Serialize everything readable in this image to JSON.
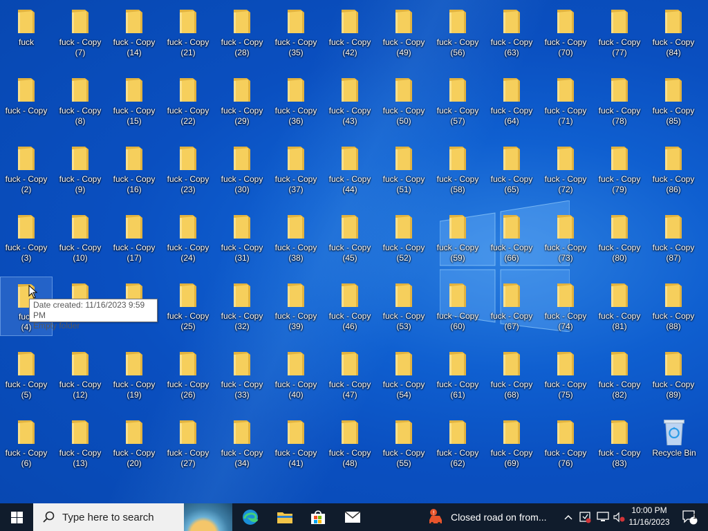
{
  "desktop": {
    "icons": [
      {
        "line1": "fuck",
        "line2": ""
      },
      {
        "line1": "fuck - Copy",
        "line2": "(7)"
      },
      {
        "line1": "fuck - Copy",
        "line2": "(14)"
      },
      {
        "line1": "fuck - Copy",
        "line2": "(21)"
      },
      {
        "line1": "fuck - Copy",
        "line2": "(28)"
      },
      {
        "line1": "fuck - Copy",
        "line2": "(35)"
      },
      {
        "line1": "fuck - Copy",
        "line2": "(42)"
      },
      {
        "line1": "fuck - Copy",
        "line2": "(49)"
      },
      {
        "line1": "fuck - Copy",
        "line2": "(56)"
      },
      {
        "line1": "fuck - Copy",
        "line2": "(63)"
      },
      {
        "line1": "fuck - Copy",
        "line2": "(70)"
      },
      {
        "line1": "fuck - Copy",
        "line2": "(77)"
      },
      {
        "line1": "fuck - Copy",
        "line2": "(84)"
      },
      {
        "line1": "fuck - Copy",
        "line2": ""
      },
      {
        "line1": "fuck - Copy",
        "line2": "(8)"
      },
      {
        "line1": "fuck - Copy",
        "line2": "(15)"
      },
      {
        "line1": "fuck - Copy",
        "line2": "(22)"
      },
      {
        "line1": "fuck - Copy",
        "line2": "(29)"
      },
      {
        "line1": "fuck - Copy",
        "line2": "(36)"
      },
      {
        "line1": "fuck - Copy",
        "line2": "(43)"
      },
      {
        "line1": "fuck - Copy",
        "line2": "(50)"
      },
      {
        "line1": "fuck - Copy",
        "line2": "(57)"
      },
      {
        "line1": "fuck - Copy",
        "line2": "(64)"
      },
      {
        "line1": "fuck - Copy",
        "line2": "(71)"
      },
      {
        "line1": "fuck - Copy",
        "line2": "(78)"
      },
      {
        "line1": "fuck - Copy",
        "line2": "(85)"
      },
      {
        "line1": "fuck - Copy",
        "line2": "(2)"
      },
      {
        "line1": "fuck - Copy",
        "line2": "(9)"
      },
      {
        "line1": "fuck - Copy",
        "line2": "(16)"
      },
      {
        "line1": "fuck - Copy",
        "line2": "(23)"
      },
      {
        "line1": "fuck - Copy",
        "line2": "(30)"
      },
      {
        "line1": "fuck - Copy",
        "line2": "(37)"
      },
      {
        "line1": "fuck - Copy",
        "line2": "(44)"
      },
      {
        "line1": "fuck - Copy",
        "line2": "(51)"
      },
      {
        "line1": "fuck - Copy",
        "line2": "(58)"
      },
      {
        "line1": "fuck - Copy",
        "line2": "(65)"
      },
      {
        "line1": "fuck - Copy",
        "line2": "(72)"
      },
      {
        "line1": "fuck - Copy",
        "line2": "(79)"
      },
      {
        "line1": "fuck - Copy",
        "line2": "(86)"
      },
      {
        "line1": "fuck - Copy",
        "line2": "(3)"
      },
      {
        "line1": "fuck - Copy",
        "line2": "(10)"
      },
      {
        "line1": "fuck - Copy",
        "line2": "(17)"
      },
      {
        "line1": "fuck - Copy",
        "line2": "(24)"
      },
      {
        "line1": "fuck - Copy",
        "line2": "(31)"
      },
      {
        "line1": "fuck - Copy",
        "line2": "(38)"
      },
      {
        "line1": "fuck - Copy",
        "line2": "(45)"
      },
      {
        "line1": "fuck - Copy",
        "line2": "(52)"
      },
      {
        "line1": "fuck - Copy",
        "line2": "(59)"
      },
      {
        "line1": "fuck - Copy",
        "line2": "(66)"
      },
      {
        "line1": "fuck - Copy",
        "line2": "(73)"
      },
      {
        "line1": "fuck - Copy",
        "line2": "(80)"
      },
      {
        "line1": "fuck - Copy",
        "line2": "(87)"
      },
      {
        "line1": "fuck",
        "line2": "(4)"
      },
      {
        "line1": "",
        "line2": "(11)"
      },
      {
        "line1": "",
        "line2": "(18)"
      },
      {
        "line1": "fuck - Copy",
        "line2": "(25)"
      },
      {
        "line1": "fuck - Copy",
        "line2": "(32)"
      },
      {
        "line1": "fuck - Copy",
        "line2": "(39)"
      },
      {
        "line1": "fuck - Copy",
        "line2": "(46)"
      },
      {
        "line1": "fuck - Copy",
        "line2": "(53)"
      },
      {
        "line1": "fuck - Copy",
        "line2": "(60)"
      },
      {
        "line1": "fuck - Copy",
        "line2": "(67)"
      },
      {
        "line1": "fuck - Copy",
        "line2": "(74)"
      },
      {
        "line1": "fuck - Copy",
        "line2": "(81)"
      },
      {
        "line1": "fuck - Copy",
        "line2": "(88)"
      },
      {
        "line1": "fuck - Copy",
        "line2": "(5)"
      },
      {
        "line1": "fuck - Copy",
        "line2": "(12)"
      },
      {
        "line1": "fuck - Copy",
        "line2": "(19)"
      },
      {
        "line1": "fuck - Copy",
        "line2": "(26)"
      },
      {
        "line1": "fuck - Copy",
        "line2": "(33)"
      },
      {
        "line1": "fuck - Copy",
        "line2": "(40)"
      },
      {
        "line1": "fuck - Copy",
        "line2": "(47)"
      },
      {
        "line1": "fuck - Copy",
        "line2": "(54)"
      },
      {
        "line1": "fuck - Copy",
        "line2": "(61)"
      },
      {
        "line1": "fuck - Copy",
        "line2": "(68)"
      },
      {
        "line1": "fuck - Copy",
        "line2": "(75)"
      },
      {
        "line1": "fuck - Copy",
        "line2": "(82)"
      },
      {
        "line1": "fuck - Copy",
        "line2": "(89)"
      },
      {
        "line1": "fuck - Copy",
        "line2": "(6)"
      },
      {
        "line1": "fuck - Copy",
        "line2": "(13)"
      },
      {
        "line1": "fuck - Copy",
        "line2": "(20)"
      },
      {
        "line1": "fuck - Copy",
        "line2": "(27)"
      },
      {
        "line1": "fuck - Copy",
        "line2": "(34)"
      },
      {
        "line1": "fuck - Copy",
        "line2": "(41)"
      },
      {
        "line1": "fuck - Copy",
        "line2": "(48)"
      },
      {
        "line1": "fuck - Copy",
        "line2": "(55)"
      },
      {
        "line1": "fuck - Copy",
        "line2": "(62)"
      },
      {
        "line1": "fuck - Copy",
        "line2": "(69)"
      },
      {
        "line1": "fuck - Copy",
        "line2": "(76)"
      },
      {
        "line1": "fuck - Copy",
        "line2": "(83)"
      }
    ],
    "recycle_bin": {
      "label": "Recycle Bin"
    },
    "tooltip": {
      "line1": "Date created: 11/16/2023 9:59 PM",
      "line2": "Empty folder"
    }
  },
  "taskbar": {
    "search_placeholder": "Type here to search",
    "news_text": "Closed road on from...",
    "clock_time": "10:00 PM",
    "clock_date": "11/16/2023",
    "notification_count": "1",
    "pinned": [
      "edge-icon",
      "file-explorer-icon",
      "store-icon",
      "mail-icon"
    ]
  },
  "colors": {
    "folder": "#f6cf5c",
    "folder_dark": "#e2b33f",
    "taskbar": "#101c2c",
    "accent": "#0a4fc0"
  }
}
